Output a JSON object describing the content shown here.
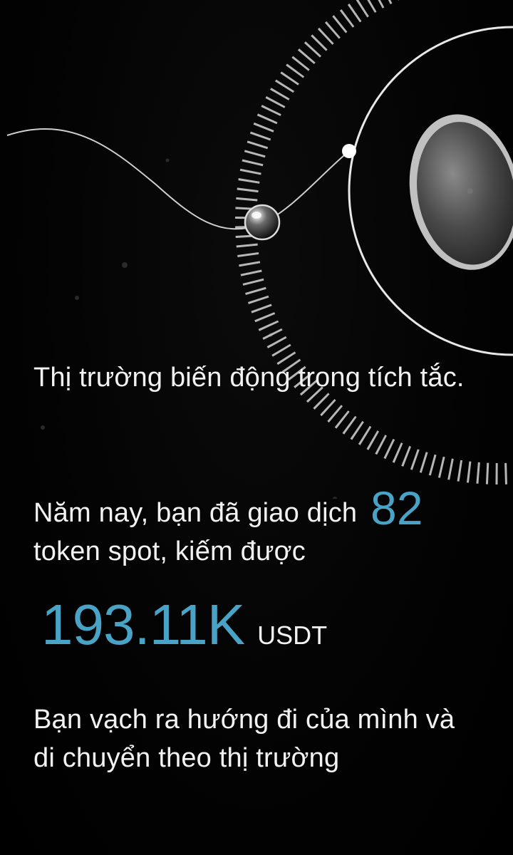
{
  "headline": "Thị trường biến động trong tích tắc.",
  "stats": {
    "prefix": "Năm nay, bạn đã giao dịch",
    "token_count": "82",
    "suffix": "token spot, kiếm được",
    "earnings_value": "193.11K",
    "earnings_unit": "USDT"
  },
  "closing": "Bạn vạch ra hướng đi của mình và di chuyển theo thị trường",
  "colors": {
    "background": "#000000",
    "accent": "#48a3c6",
    "text": "#f2f2f2"
  }
}
